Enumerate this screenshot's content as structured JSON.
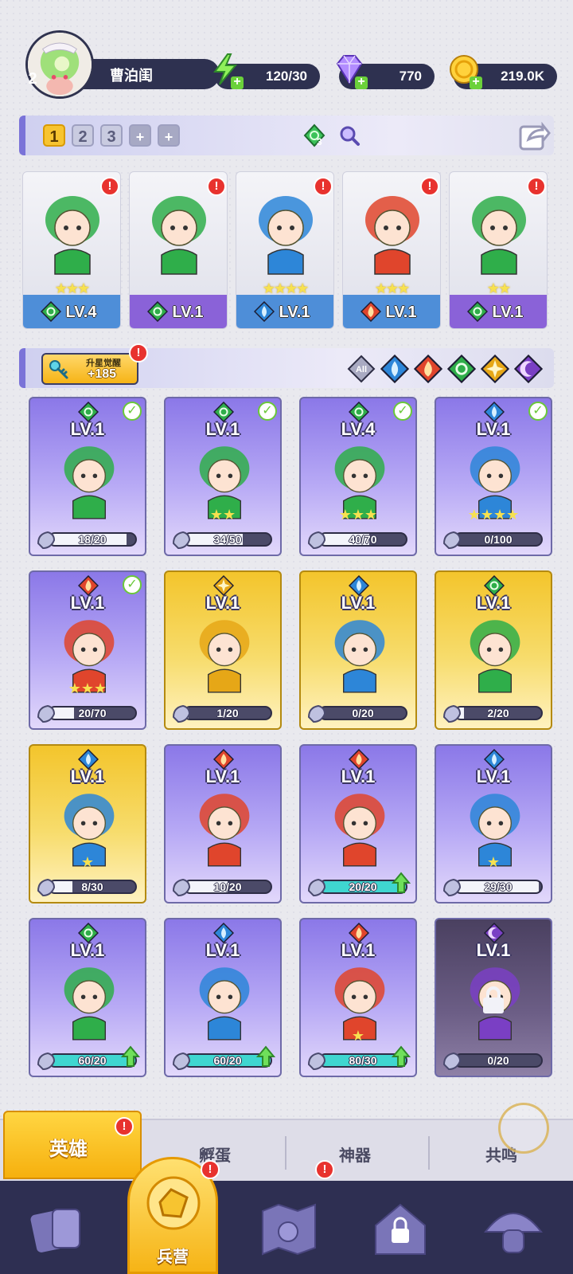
{
  "player": {
    "level": "2",
    "name": "曹泊闺"
  },
  "resources": {
    "energy": "120/30",
    "gems": "770",
    "gold": "219.0K"
  },
  "team_bar": {
    "tabs": [
      "1",
      "2",
      "3",
      "+",
      "+"
    ],
    "active_tab": "1",
    "gem_count": "3"
  },
  "team": [
    {
      "level": "LV.4",
      "element": "wind",
      "stars": "★★★",
      "bottom_color": "#4e8ed8"
    },
    {
      "level": "LV.1",
      "element": "wind",
      "stars": "",
      "bottom_color": "#8a62d8"
    },
    {
      "level": "LV.1",
      "element": "water",
      "stars": "★★★★",
      "bottom_color": "#4e8ed8"
    },
    {
      "level": "LV.1",
      "element": "fire",
      "stars": "★★★",
      "bottom_color": "#4e8ed8"
    },
    {
      "level": "LV.1",
      "element": "wind",
      "stars": "★★",
      "bottom_color": "#8a62d8"
    }
  ],
  "filter_bar": {
    "awaken_label": "升星觉醒",
    "awaken_value": "+185",
    "filters": [
      "All",
      "water",
      "fire",
      "wind",
      "light",
      "dark"
    ]
  },
  "heroes": [
    {
      "level": "LV.1",
      "element": "wind",
      "progress": "18/20",
      "fill": 0.9,
      "style": "purple",
      "checked": true,
      "upgrade": false,
      "stars": ""
    },
    {
      "level": "LV.1",
      "element": "wind",
      "progress": "34/50",
      "fill": 0.68,
      "style": "purple",
      "checked": true,
      "upgrade": false,
      "stars": "★★"
    },
    {
      "level": "LV.4",
      "element": "wind",
      "progress": "40/70",
      "fill": 0.57,
      "style": "purple",
      "checked": true,
      "upgrade": false,
      "stars": "★★★"
    },
    {
      "level": "LV.1",
      "element": "water",
      "progress": "0/100",
      "fill": 0.0,
      "style": "purple",
      "checked": true,
      "upgrade": false,
      "stars": "★★★★"
    },
    {
      "level": "LV.1",
      "element": "fire",
      "progress": "20/70",
      "fill": 0.29,
      "style": "purple",
      "checked": true,
      "upgrade": false,
      "stars": "★★★"
    },
    {
      "level": "LV.1",
      "element": "light",
      "progress": "1/20",
      "fill": 0.05,
      "style": "gold",
      "checked": false,
      "upgrade": false,
      "stars": ""
    },
    {
      "level": "LV.1",
      "element": "water",
      "progress": "0/20",
      "fill": 0.0,
      "style": "gold",
      "checked": false,
      "upgrade": false,
      "stars": ""
    },
    {
      "level": "LV.1",
      "element": "wind",
      "progress": "2/20",
      "fill": 0.1,
      "style": "gold",
      "checked": false,
      "upgrade": false,
      "stars": ""
    },
    {
      "level": "LV.1",
      "element": "water",
      "progress": "8/30",
      "fill": 0.27,
      "style": "gold",
      "checked": false,
      "upgrade": false,
      "stars": "★"
    },
    {
      "level": "LV.1",
      "element": "fire",
      "progress": "10/20",
      "fill": 0.5,
      "style": "purple",
      "checked": false,
      "upgrade": false,
      "stars": ""
    },
    {
      "level": "LV.1",
      "element": "fire",
      "progress": "20/20",
      "fill": 1.0,
      "style": "purple",
      "checked": false,
      "upgrade": true,
      "stars": ""
    },
    {
      "level": "LV.1",
      "element": "water",
      "progress": "29/30",
      "fill": 0.97,
      "style": "purple",
      "checked": false,
      "upgrade": false,
      "stars": "★"
    },
    {
      "level": "LV.1",
      "element": "wind",
      "progress": "60/20",
      "fill": 1.0,
      "style": "purple",
      "checked": false,
      "upgrade": true,
      "stars": ""
    },
    {
      "level": "LV.1",
      "element": "water",
      "progress": "60/20",
      "fill": 1.0,
      "style": "purple",
      "checked": false,
      "upgrade": true,
      "stars": ""
    },
    {
      "level": "LV.1",
      "element": "fire",
      "progress": "80/30",
      "fill": 1.0,
      "style": "purple",
      "checked": false,
      "upgrade": true,
      "stars": "★"
    },
    {
      "level": "LV.1",
      "element": "dark",
      "progress": "0/20",
      "fill": 0.0,
      "style": "locked",
      "checked": false,
      "upgrade": false,
      "stars": ""
    }
  ],
  "sub_tabs": {
    "active": "英雄",
    "items": [
      "孵蛋",
      "神器",
      "共鸣"
    ]
  },
  "nav": {
    "active_label": "兵营"
  },
  "colors": {
    "wind": "#2fae4a",
    "water": "#2d86d8",
    "fire": "#e0452c",
    "light": "#e6a717",
    "dark": "#7a3fc4",
    "accent_gold": "#f6b416",
    "nav_bg": "#2e2f52"
  }
}
